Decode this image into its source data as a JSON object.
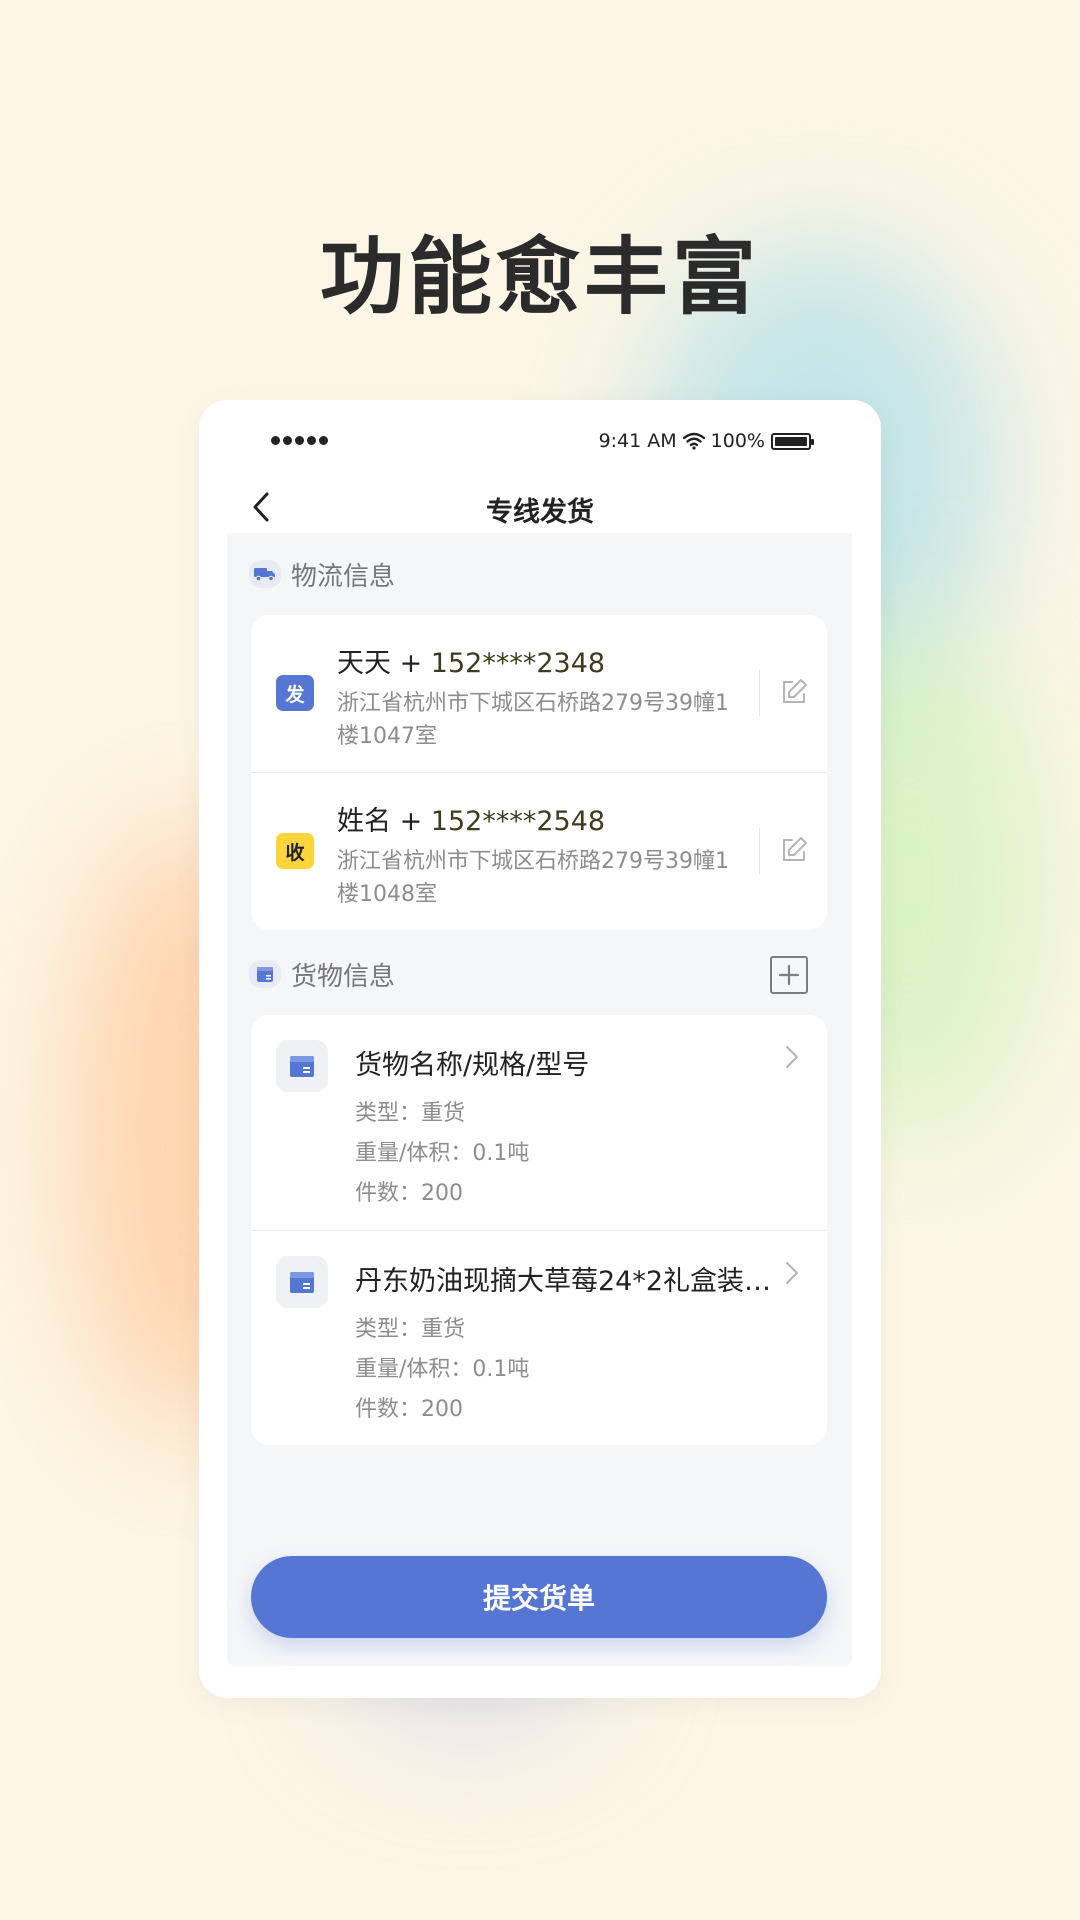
{
  "headline": "功能愈丰富",
  "status_bar": {
    "time": "9:41 AM",
    "battery": "100%"
  },
  "nav": {
    "title": "专线发货"
  },
  "logistics": {
    "section_label": "物流信息",
    "sender": {
      "badge": "发",
      "name": "天天 + ",
      "phone": "152****2348",
      "address": "浙江省杭州市下城区石桥路279号39幢1楼1047室"
    },
    "receiver": {
      "badge": "收",
      "name": "姓名 + ",
      "phone": "152****2548",
      "address": "浙江省杭州市下城区石桥路279号39幢1楼1048室"
    }
  },
  "goods": {
    "section_label": "货物信息",
    "items": [
      {
        "name": "货物名称/规格/型号",
        "type": "类型：重货",
        "weight": "重量/体积：0.1吨",
        "count": "件数：200"
      },
      {
        "name": "丹东奶油现摘大草莓24*2礼盒装…",
        "type": "类型：重货",
        "weight": "重量/体积：0.1吨",
        "count": "件数：200"
      }
    ]
  },
  "submit_label": "提交货单",
  "colors": {
    "background": "#fdf6e6",
    "accent": "#5577d3",
    "receiver_badge": "#ffd43a"
  },
  "icons": {
    "logistics_section": "truck-icon",
    "goods_section": "box-icon",
    "edit": "edit-icon",
    "add": "plus-square-icon",
    "back": "chevron-left-icon",
    "chevron": "chevron-right-icon"
  }
}
